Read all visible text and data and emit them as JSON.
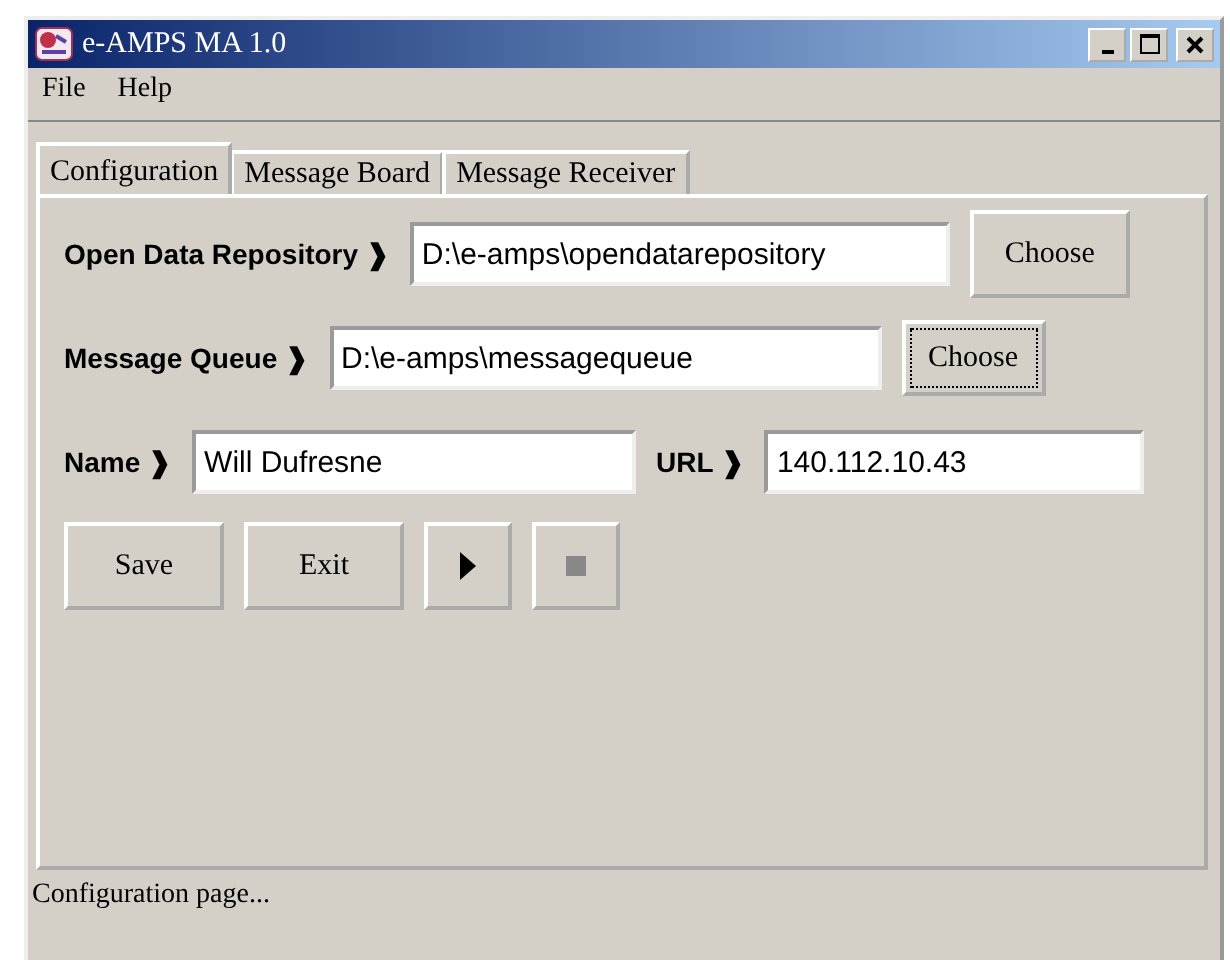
{
  "window": {
    "title": "e-AMPS MA 1.0"
  },
  "menu": [
    "File",
    "Help"
  ],
  "tabs": [
    {
      "label": "Configuration",
      "selected": true
    },
    {
      "label": "Message Board",
      "selected": false
    },
    {
      "label": "Message Receiver",
      "selected": false
    }
  ],
  "rows": [
    [
      {
        "kind": "label",
        "text": "Open Data Repository ❱"
      },
      {
        "kind": "field",
        "value": "D:\\e-amps\\opendatarepository"
      },
      {
        "kind": "button",
        "label": "Choose",
        "focused": false
      }
    ],
    [
      {
        "kind": "label",
        "text": "Message Queue ❱"
      },
      {
        "kind": "field",
        "value": "D:\\e-amps\\messagequeue"
      },
      {
        "kind": "button",
        "label": "Choose",
        "focused": true
      }
    ],
    [
      {
        "kind": "label",
        "text": "Name ❱"
      },
      {
        "kind": "field",
        "value": "Will Dufresne"
      },
      {
        "kind": "label",
        "text": "URL ❱"
      },
      {
        "kind": "field",
        "value": "140.112.10.43"
      }
    ],
    [
      {
        "kind": "button",
        "label": "Save",
        "focused": false
      },
      {
        "kind": "button",
        "label": "Exit",
        "focused": false
      },
      {
        "kind": "play",
        "disabled": false
      },
      {
        "kind": "stop",
        "disabled": true
      }
    ]
  ],
  "status_bar": "Configuration page..."
}
